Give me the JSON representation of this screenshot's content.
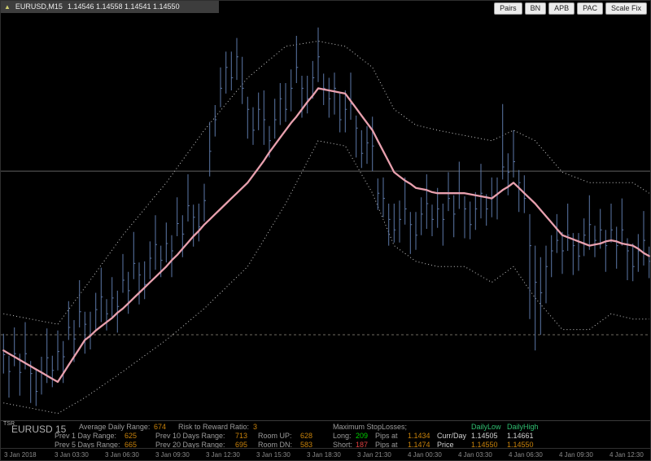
{
  "window": {
    "title_symbol": "EURUSD,M15",
    "title_quotes": "1.14546 1.14558 1.14541 1.14550",
    "buttons": [
      "Pairs",
      "BN",
      "APB",
      "PAC",
      "Scale Fix"
    ]
  },
  "chart_data": {
    "type": "candlestick",
    "symbol": "EURUSD",
    "timeframe": "M15",
    "price_base": 1.14,
    "pip_factor": 0.0001,
    "ylim": [
      1.14425,
      1.14811
    ],
    "levels": {
      "daily_high_line": 1.14661,
      "daily_low_line": 1.14505
    },
    "x_tick_labels": [
      "3 Jan 2018",
      "3 Jan 03:30",
      "3 Jan 06:30",
      "3 Jan 09:30",
      "3 Jan 12:30",
      "3 Jan 15:30",
      "3 Jan 18:30",
      "3 Jan 21:30",
      "4 Jan 00:30",
      "4 Jan 03:30",
      "4 Jan 06:30",
      "4 Jan 09:30",
      "4 Jan 12:30"
    ],
    "bars": {
      "high_pips": [
        50.6,
        48.5,
        51.2,
        48.7,
        51.7,
        48.0,
        47.3,
        48.4,
        51.1,
        48.5,
        50.9,
        49.9,
        53.7,
        51.9,
        55.7,
        52.7,
        52.7,
        54.5,
        56.9,
        53.9,
        56.0,
        54.7,
        58.2,
        56.5,
        60.3,
        57.4,
        57.5,
        59.4,
        61.9,
        59.0,
        61.2,
        60.0,
        63.6,
        61.9,
        65.8,
        62.9,
        63.0,
        64.9,
        70.8,
        72.4,
        76.0,
        77.5,
        77.5,
        78.8,
        77.0,
        73.2,
        72.2,
        73.6,
        73.8,
        70.4,
        73.0,
        74.5,
        74.5,
        75.8,
        79.0,
        75.2,
        75.2,
        76.6,
        79.8,
        75.4,
        75.0,
        75.5,
        73.5,
        73.8,
        75.5,
        71.4,
        70.0,
        70.4,
        71.3,
        65.4,
        65.5,
        63.0,
        63.0,
        63.3,
        65.5,
        62.2,
        62.2,
        63.6,
        65.8,
        62.9,
        64.5,
        63.0,
        66.0,
        63.8,
        67.0,
        63.7,
        63.2,
        64.1,
        66.8,
        63.9,
        65.5,
        65.5,
        72.5,
        67.8,
        70.0,
        66.2,
        65.7,
        62.0,
        59.0,
        57.9,
        59.0,
        60.0,
        62.0,
        60.3,
        63.0,
        60.2,
        60.2,
        61.6,
        63.8,
        60.9,
        62.5,
        60.5,
        63.0,
        60.8,
        63.5,
        59.7,
        59.2,
        60.1,
        62.3,
        58.9
      ],
      "low_pips": [
        46.8,
        44.5,
        47.5,
        44.7,
        47.2,
        44.0,
        43.7,
        44.8,
        45.9,
        45.5,
        47.1,
        45.9,
        50.0,
        47.9,
        51.2,
        48.7,
        49.1,
        50.9,
        51.7,
        50.9,
        52.2,
        50.7,
        54.5,
        52.5,
        55.8,
        53.4,
        53.9,
        55.8,
        56.7,
        56.0,
        57.4,
        56.0,
        59.9,
        57.9,
        61.3,
        58.9,
        59.4,
        61.3,
        65.6,
        69.4,
        72.2,
        73.5,
        73.8,
        74.8,
        72.5,
        69.2,
        68.6,
        70.0,
        68.6,
        67.4,
        69.2,
        70.5,
        70.8,
        71.8,
        74.5,
        71.2,
        71.6,
        73.0,
        74.6,
        72.4,
        71.2,
        71.5,
        69.8,
        69.8,
        71.0,
        67.4,
        66.4,
        66.8,
        66.1,
        62.4,
        61.7,
        59.0,
        59.3,
        59.3,
        61.0,
        58.2,
        58.6,
        60.0,
        60.6,
        59.9,
        60.7,
        59.0,
        62.3,
        59.8,
        62.5,
        59.7,
        59.6,
        60.5,
        61.6,
        60.9,
        61.7,
        61.5,
        65.3,
        63.8,
        65.5,
        62.2,
        62.1,
        52.0,
        49.0,
        50.5,
        53.5,
        56.0,
        58.3,
        56.3,
        58.5,
        56.2,
        56.6,
        58.0,
        58.6,
        57.9,
        58.7,
        56.5,
        59.3,
        56.8,
        59.0,
        55.7,
        55.6,
        56.5,
        57.1,
        55.9
      ],
      "close_pips": [
        48.6,
        47.0,
        48.7,
        46.9,
        48.7,
        46.8,
        45.1,
        46.8,
        48.3,
        47.1,
        48.9,
        48.4,
        51.2,
        50.1,
        52.7,
        51.5,
        50.5,
        52.9,
        54.1,
        52.5,
        54.0,
        53.2,
        55.7,
        54.7,
        57.3,
        56.2,
        55.3,
        57.8,
        59.1,
        57.6,
        59.2,
        58.5,
        61.1,
        60.1,
        62.8,
        61.7,
        60.8,
        63.3,
        68.0,
        71.0,
        74.0,
        76.0,
        75.0,
        77.0,
        74.0,
        72.0,
        70.0,
        72.0,
        71.0,
        69.0,
        71.0,
        73.0,
        72.0,
        74.0,
        76.0,
        74.0,
        73.0,
        75.0,
        77.0,
        74.0,
        73.0,
        74.0,
        71.0,
        72.0,
        72.5,
        70.2,
        67.8,
        68.8,
        68.5,
        64.0,
        63.5,
        61.5,
        60.5,
        61.5,
        62.5,
        61.0,
        60.0,
        62.0,
        63.0,
        61.5,
        62.5,
        61.5,
        63.5,
        62.0,
        64.0,
        62.5,
        61.0,
        62.5,
        64.0,
        62.5,
        63.5,
        64.0,
        66.5,
        66.0,
        67.0,
        65.0,
        63.5,
        59.0,
        55.5,
        54.5,
        57.0,
        58.5,
        59.5,
        58.5,
        60.0,
        59.0,
        58.0,
        60.0,
        61.0,
        59.5,
        60.5,
        59.0,
        60.5,
        59.0,
        60.5,
        58.5,
        57.0,
        58.5,
        59.5,
        57.5
      ]
    },
    "ma_pips": [
      49.0,
      48.7,
      48.4,
      48.1,
      47.8,
      47.5,
      47.2,
      46.9,
      46.6,
      46.3,
      46.0,
      46.8,
      47.6,
      48.4,
      49.2,
      50.0,
      50.4,
      50.9,
      51.3,
      51.7,
      52.1,
      52.6,
      53.0,
      53.5,
      54.0,
      54.5,
      55.0,
      55.5,
      56.0,
      56.5,
      57.0,
      57.6,
      58.1,
      58.7,
      59.3,
      59.9,
      60.4,
      61.0,
      61.5,
      62.0,
      62.5,
      63.0,
      63.5,
      64.0,
      64.5,
      65.0,
      65.7,
      66.4,
      67.1,
      67.9,
      68.6,
      69.3,
      70.0,
      70.7,
      71.3,
      72.0,
      72.7,
      73.3,
      74.0,
      73.9,
      73.8,
      73.7,
      73.6,
      73.5,
      72.8,
      72.1,
      71.4,
      70.7,
      70.0,
      69.0,
      68.0,
      67.0,
      66.0,
      65.6,
      65.2,
      64.9,
      64.5,
      64.4,
      64.3,
      64.1,
      64.0,
      64.0,
      64.0,
      64.0,
      64.0,
      64.0,
      63.9,
      63.8,
      63.7,
      63.6,
      63.5,
      63.9,
      64.3,
      64.6,
      65.0,
      64.5,
      64.0,
      63.5,
      63.0,
      62.4,
      61.8,
      61.2,
      60.6,
      60.0,
      59.8,
      59.6,
      59.4,
      59.2,
      59.0,
      59.1,
      59.2,
      59.4,
      59.5,
      59.4,
      59.2,
      59.1,
      59.0,
      58.7,
      58.3,
      58.0
    ],
    "upper_band_keypoints": [
      [
        0,
        52.5
      ],
      [
        10,
        51.5
      ],
      [
        15,
        55
      ],
      [
        22,
        60
      ],
      [
        30,
        65
      ],
      [
        37,
        70
      ],
      [
        45,
        75
      ],
      [
        52,
        78
      ],
      [
        58,
        78.5
      ],
      [
        63,
        78
      ],
      [
        68,
        76
      ],
      [
        72,
        72
      ],
      [
        76,
        70.5
      ],
      [
        80,
        70
      ],
      [
        85,
        69.5
      ],
      [
        90,
        69
      ],
      [
        94,
        70
      ],
      [
        98,
        69
      ],
      [
        103,
        66
      ],
      [
        108,
        65
      ],
      [
        112,
        65
      ],
      [
        116,
        65
      ],
      [
        119,
        64
      ]
    ],
    "lower_band_keypoints": [
      [
        0,
        44
      ],
      [
        10,
        43
      ],
      [
        15,
        44.5
      ],
      [
        22,
        47
      ],
      [
        30,
        50
      ],
      [
        37,
        53
      ],
      [
        45,
        57
      ],
      [
        52,
        63
      ],
      [
        58,
        69
      ],
      [
        63,
        68.5
      ],
      [
        68,
        64
      ],
      [
        72,
        59
      ],
      [
        76,
        57.5
      ],
      [
        80,
        57
      ],
      [
        85,
        57
      ],
      [
        90,
        55.5
      ],
      [
        94,
        57
      ],
      [
        98,
        54
      ],
      [
        103,
        51
      ],
      [
        108,
        51
      ],
      [
        112,
        52.5
      ],
      [
        116,
        52
      ],
      [
        119,
        52
      ]
    ],
    "colors": {
      "bars": "#5d78a8",
      "ma": "#e8a0ae",
      "bands": "#c9c9c9",
      "level_solid": "#616161",
      "level_dotted": "#6e6a60"
    }
  },
  "info_panel": {
    "indicator_tag": "TSR",
    "indicator_title": "EURUSD 15",
    "avg_daily_range_label": "Average Daily Range:",
    "avg_daily_range": "674",
    "risk_reward_label": "Risk to Reward Ratio:",
    "risk_reward": "3",
    "max_stoploss_label": "Maximum StopLosses;",
    "prev1_label": "Prev 1 Day Range:",
    "prev1": "625",
    "prev5_label": "Prev 5 Days Range:",
    "prev5": "665",
    "prev10_label": "Prev 10 Days Range:",
    "prev10": "713",
    "prev20_label": "Prev 20 Days Range:",
    "prev20": "695",
    "room_up_label": "Room UP:",
    "room_up": "628",
    "room_dn_label": "Room DN:",
    "room_dn": "583",
    "long_label": "Long:",
    "long_pips": "209",
    "long_suffix": "Pips at",
    "long_price": "1.1434",
    "short_label": "Short:",
    "short_pips": "187",
    "short_suffix": "Pips at",
    "short_price": "1.1474",
    "daily_low_header": "DailyLow",
    "daily_high_header": "DailyHigh",
    "curr_day_label": "Curr/Day",
    "curr_day_low": "1.14505",
    "curr_day_high": "1.14661",
    "price_label": "Price",
    "price_low": "1.14550",
    "price_high": "1.14550"
  }
}
